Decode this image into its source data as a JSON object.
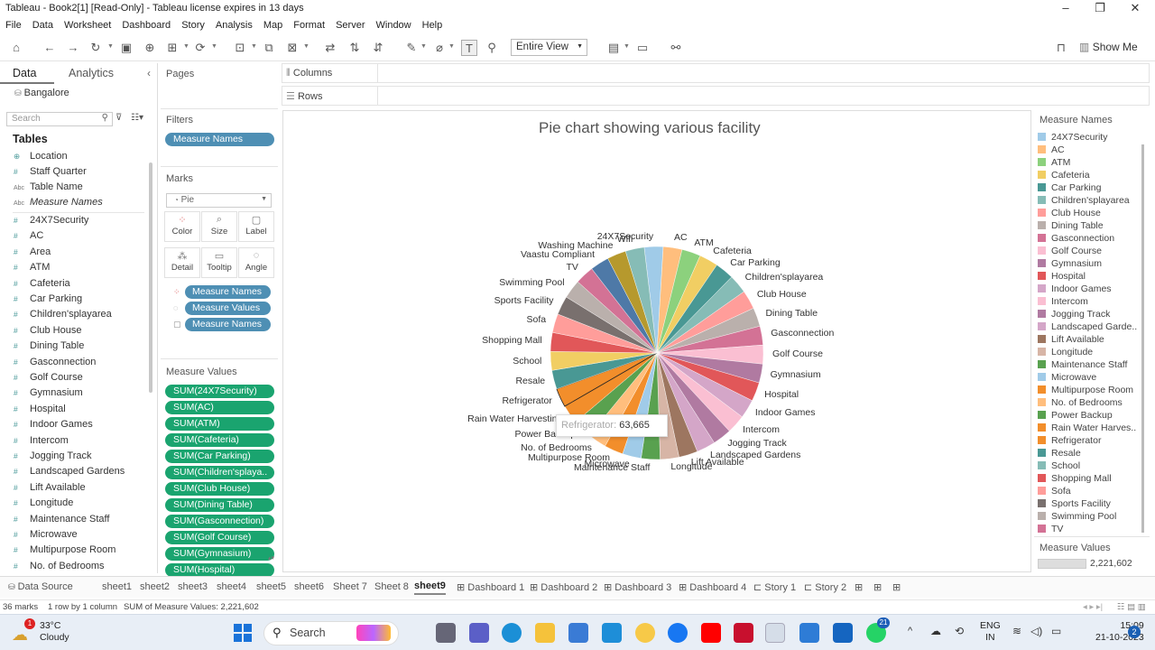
{
  "window": {
    "title": "Tableau - Book2[1] [Read-Only] - Tableau license expires in 13 days"
  },
  "menu": [
    "File",
    "Data",
    "Worksheet",
    "Dashboard",
    "Story",
    "Analysis",
    "Map",
    "Format",
    "Server",
    "Window",
    "Help"
  ],
  "toolbar": {
    "view_select": "Entire View",
    "show_me": "Show Me"
  },
  "left_panel": {
    "tab_data": "Data",
    "tab_analytics": "Analytics",
    "datasource": "Bangalore",
    "search_placeholder": "Search",
    "tables_heading": "Tables",
    "dimensions": [
      {
        "name": "Location",
        "icon": "globe"
      },
      {
        "name": "Staff Quarter",
        "icon": "hash"
      },
      {
        "name": "Table Name",
        "icon": "abc"
      },
      {
        "name": "Measure Names",
        "icon": "abc"
      }
    ],
    "measures": [
      "24X7Security",
      "AC",
      "Area",
      "ATM",
      "Cafeteria",
      "Car Parking",
      "Children'splayarea",
      "Club House",
      "Dining Table",
      "Gasconnection",
      "Golf Course",
      "Gymnasium",
      "Hospital",
      "Indoor Games",
      "Intercom",
      "Jogging Track",
      "Landscaped Gardens",
      "Lift Available",
      "Longitude",
      "Maintenance Staff",
      "Microwave",
      "Multipurpose Room",
      "No. of Bedrooms"
    ]
  },
  "cards": {
    "pages": "Pages",
    "filters": "Filters",
    "filter_pills": [
      "Measure Names"
    ],
    "marks": "Marks",
    "marks_type": "Pie",
    "mark_buttons": [
      "Color",
      "Size",
      "Label",
      "Detail",
      "Tooltip",
      "Angle"
    ],
    "mark_pills": [
      "Measure Names",
      "Measure Values",
      "Measure Names"
    ],
    "measure_values": "Measure Values",
    "mv_pills": [
      "SUM(24X7Security)",
      "SUM(AC)",
      "SUM(ATM)",
      "SUM(Cafeteria)",
      "SUM(Car Parking)",
      "SUM(Children'splaya..",
      "SUM(Club House)",
      "SUM(Dining Table)",
      "SUM(Gasconnection)",
      "SUM(Golf Course)",
      "SUM(Gymnasium)",
      "SUM(Hospital)"
    ]
  },
  "shelves": {
    "columns": "Columns",
    "rows": "Rows"
  },
  "chart_data": {
    "type": "pie",
    "title": "Pie chart showing various facility",
    "slices": [
      {
        "label": "24X7Security",
        "color": "#a0cbe8",
        "value": 2.8
      },
      {
        "label": "AC",
        "color": "#ffbe7d",
        "value": 2.8
      },
      {
        "label": "ATM",
        "color": "#8cd17d",
        "value": 2.8
      },
      {
        "label": "Cafeteria",
        "color": "#f1ce63",
        "value": 2.8
      },
      {
        "label": "Car Parking",
        "color": "#499894",
        "value": 2.8
      },
      {
        "label": "Children'splayarea",
        "color": "#86bcb6",
        "value": 2.8
      },
      {
        "label": "Club House",
        "color": "#ff9d9a",
        "value": 2.8
      },
      {
        "label": "Dining Table",
        "color": "#bab0ac",
        "value": 2.8
      },
      {
        "label": "Gasconnection",
        "color": "#d37295",
        "value": 2.8
      },
      {
        "label": "Golf Course",
        "color": "#fabfd2",
        "value": 2.8
      },
      {
        "label": "Gymnasium",
        "color": "#b07aa1",
        "value": 2.8
      },
      {
        "label": "Hospital",
        "color": "#e15759",
        "value": 2.8
      },
      {
        "label": "Indoor Games",
        "color": "#d4a6c8",
        "value": 2.8
      },
      {
        "label": "Intercom",
        "color": "#fabfd2",
        "value": 2.8
      },
      {
        "label": "Jogging Track",
        "color": "#b07aa1",
        "value": 2.8
      },
      {
        "label": "Landscaped Gardens",
        "color": "#d4a6c8",
        "value": 2.8
      },
      {
        "label": "Lift Available",
        "color": "#9d7660",
        "value": 2.8
      },
      {
        "label": "Longitude",
        "color": "#d7b5a6",
        "value": 2.8
      },
      {
        "label": "Maintenance Staff",
        "color": "#59a14f",
        "value": 2.8
      },
      {
        "label": "Microwave",
        "color": "#a0cbe8",
        "value": 2.8
      },
      {
        "label": "Multipurpose Room",
        "color": "#f28e2b",
        "value": 2.8
      },
      {
        "label": "No. of Bedrooms",
        "color": "#ffbe7d",
        "value": 2.8
      },
      {
        "label": "Power Backup",
        "color": "#59a14f",
        "value": 2.8
      },
      {
        "label": "Rain Water Harvesting",
        "color": "#f28e2b",
        "value": 2.8
      },
      {
        "label": "Refrigerator",
        "color": "#f28e2b",
        "value": 2.8
      },
      {
        "label": "Resale",
        "color": "#499894",
        "value": 2.8
      },
      {
        "label": "School",
        "color": "#f1ce63",
        "value": 2.8
      },
      {
        "label": "Shopping Mall",
        "color": "#e15759",
        "value": 2.8
      },
      {
        "label": "Sofa",
        "color": "#ff9d9a",
        "value": 2.8
      },
      {
        "label": "Sports Facility",
        "color": "#79706e",
        "value": 2.8
      },
      {
        "label": "Swimming Pool",
        "color": "#bab0ac",
        "value": 2.8
      },
      {
        "label": "TV",
        "color": "#d37295",
        "value": 2.8
      },
      {
        "label": "Vaastu Compliant",
        "color": "#4e79a7",
        "value": 2.8
      },
      {
        "label": "Washing Machine",
        "color": "#b6992d",
        "value": 2.8
      },
      {
        "label": "Wifi",
        "color": "#86bcb6",
        "value": 2.8
      }
    ],
    "tooltip": {
      "label": "Refrigerator:",
      "value": "63,665"
    }
  },
  "legend": {
    "title": "Measure Names",
    "items": [
      {
        "label": "24X7Security",
        "color": "#a0cbe8"
      },
      {
        "label": "AC",
        "color": "#ffbe7d"
      },
      {
        "label": "ATM",
        "color": "#8cd17d"
      },
      {
        "label": "Cafeteria",
        "color": "#f1ce63"
      },
      {
        "label": "Car Parking",
        "color": "#499894"
      },
      {
        "label": "Children'splayarea",
        "color": "#86bcb6"
      },
      {
        "label": "Club House",
        "color": "#ff9d9a"
      },
      {
        "label": "Dining Table",
        "color": "#bab0ac"
      },
      {
        "label": "Gasconnection",
        "color": "#d37295"
      },
      {
        "label": "Golf Course",
        "color": "#fabfd2"
      },
      {
        "label": "Gymnasium",
        "color": "#b07aa1"
      },
      {
        "label": "Hospital",
        "color": "#e15759"
      },
      {
        "label": "Indoor Games",
        "color": "#d4a6c8"
      },
      {
        "label": "Intercom",
        "color": "#fabfd2"
      },
      {
        "label": "Jogging Track",
        "color": "#b07aa1"
      },
      {
        "label": "Landscaped Garde..",
        "color": "#d4a6c8"
      },
      {
        "label": "Lift Available",
        "color": "#9d7660"
      },
      {
        "label": "Longitude",
        "color": "#d7b5a6"
      },
      {
        "label": "Maintenance Staff",
        "color": "#59a14f"
      },
      {
        "label": "Microwave",
        "color": "#a0cbe8"
      },
      {
        "label": "Multipurpose Room",
        "color": "#f28e2b"
      },
      {
        "label": "No. of Bedrooms",
        "color": "#ffbe7d"
      },
      {
        "label": "Power Backup",
        "color": "#59a14f"
      },
      {
        "label": "Rain Water Harves..",
        "color": "#f28e2b"
      },
      {
        "label": "Refrigerator",
        "color": "#f28e2b"
      },
      {
        "label": "Resale",
        "color": "#499894"
      },
      {
        "label": "School",
        "color": "#86bcb6"
      },
      {
        "label": "Shopping Mall",
        "color": "#e15759"
      },
      {
        "label": "Sofa",
        "color": "#ff9d9a"
      },
      {
        "label": "Sports Facility",
        "color": "#79706e"
      },
      {
        "label": "Swimming Pool",
        "color": "#bab0ac"
      },
      {
        "label": "TV",
        "color": "#d37295"
      }
    ],
    "mv_title": "Measure Values",
    "mv_value": "2,221,602"
  },
  "sheet_tabs": [
    "Data Source",
    "sheet1",
    "sheet2",
    "sheet3",
    "sheet4",
    "sheet5",
    "sheet6",
    "Sheet 7",
    "Sheet 8",
    "sheet9",
    "Dashboard 1",
    "Dashboard 2",
    "Dashboard 3",
    "Dashboard 4",
    "Story 1",
    "Story 2"
  ],
  "active_tab": "sheet9",
  "status": {
    "marks": "36 marks",
    "rowcol": "1 row by 1 column",
    "sum": "SUM of Measure Values: 2,221,602"
  },
  "taskbar": {
    "temp": "33°C",
    "weather": "Cloudy",
    "weather_badge": "1",
    "search": "Search",
    "lang1": "ENG",
    "lang2": "IN",
    "time": "15:09",
    "date": "21-10-2023",
    "notif": "2",
    "whatsapp_badge": "21"
  }
}
